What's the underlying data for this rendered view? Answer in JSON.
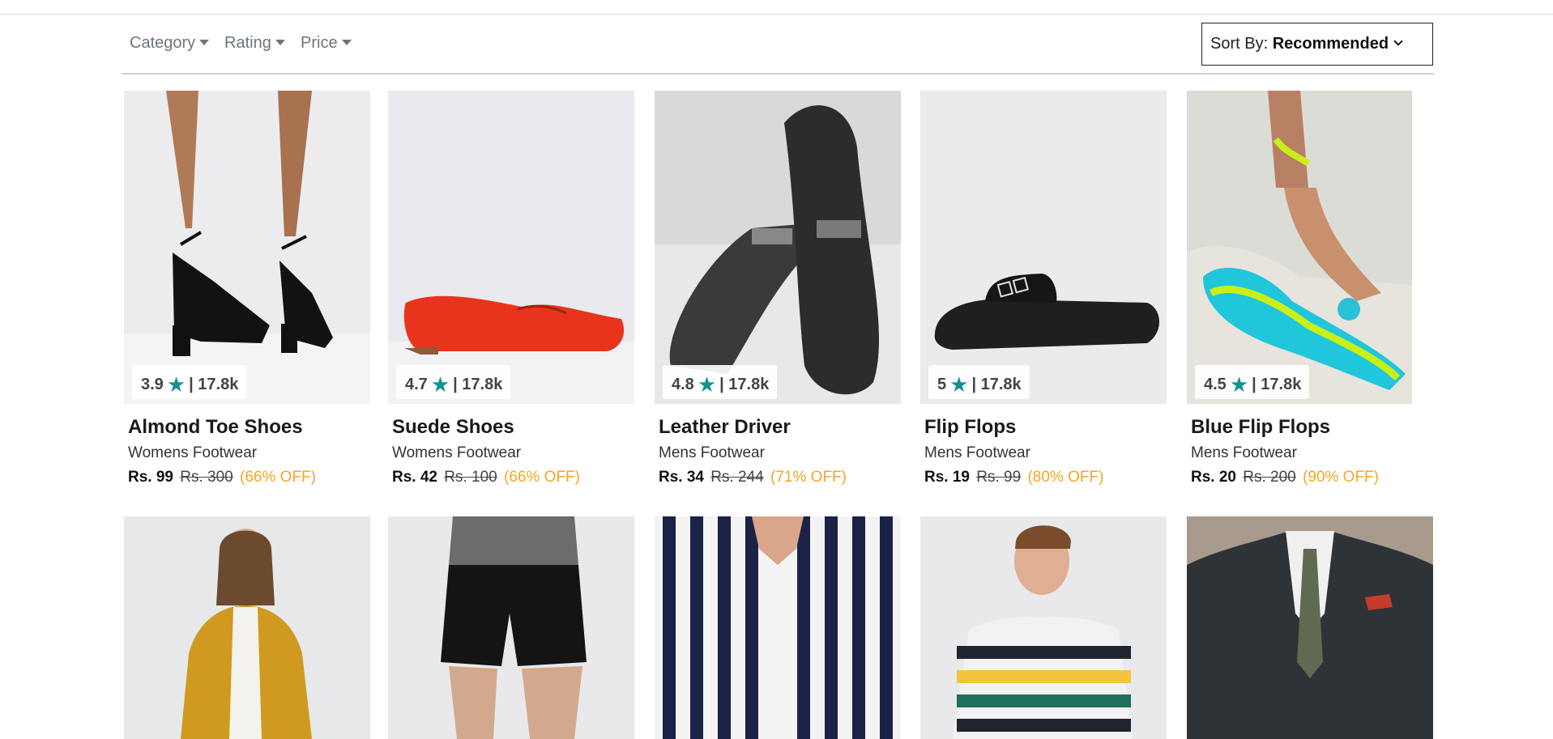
{
  "filters": {
    "category": "Category",
    "rating": "Rating",
    "price": "Price"
  },
  "sort": {
    "prefix": "Sort By: ",
    "value": "Recommended"
  },
  "products": [
    {
      "rating": "3.9",
      "reviews": "| 17.8k",
      "name": "Almond Toe Shoes",
      "category": "Womens Footwear",
      "price": "Rs. 99",
      "original_price": "Rs. 300",
      "discount": "(66% OFF)"
    },
    {
      "rating": "4.7",
      "reviews": "| 17.8k",
      "name": "Suede Shoes",
      "category": "Womens Footwear",
      "price": "Rs. 42",
      "original_price": "Rs. 100",
      "discount": "(66% OFF)"
    },
    {
      "rating": "4.8",
      "reviews": "| 17.8k",
      "name": "Leather Driver",
      "category": "Mens Footwear",
      "price": "Rs. 34",
      "original_price": "Rs. 244",
      "discount": "(71% OFF)"
    },
    {
      "rating": "5",
      "reviews": "| 17.8k",
      "name": "Flip Flops",
      "category": "Mens Footwear",
      "price": "Rs. 19",
      "original_price": "Rs. 99",
      "discount": "(80% OFF)"
    },
    {
      "rating": "4.5",
      "reviews": "| 17.8k",
      "name": "Blue Flip Flops",
      "category": "Mens Footwear",
      "price": "Rs. 20",
      "original_price": "Rs. 200",
      "discount": "(90% OFF)"
    }
  ],
  "icons": {
    "rating": "star-icon",
    "dropdown": "caret-down-icon"
  },
  "colors": {
    "star": "#13918f",
    "discount": "#f5a623"
  }
}
